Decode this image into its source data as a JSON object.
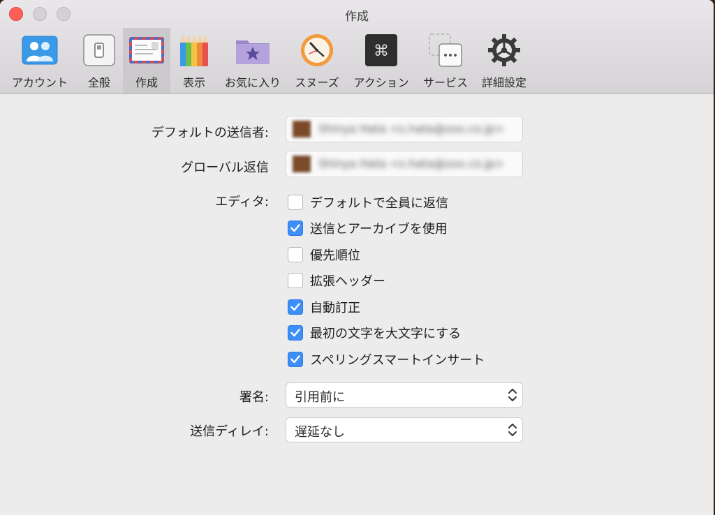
{
  "window": {
    "title": "作成"
  },
  "toolbar": {
    "items": [
      {
        "label": "アカウント",
        "icon": "accounts-icon"
      },
      {
        "label": "全般",
        "icon": "general-switch-icon"
      },
      {
        "label": "作成",
        "icon": "airmail-envelope-icon",
        "selected": true
      },
      {
        "label": "表示",
        "icon": "color-pencils-icon"
      },
      {
        "label": "お気に入り",
        "icon": "star-folder-icon"
      },
      {
        "label": "スヌーズ",
        "icon": "clock-icon"
      },
      {
        "label": "アクション",
        "icon": "command-key-icon"
      },
      {
        "label": "サービス",
        "icon": "services-dots-icon"
      },
      {
        "label": "詳細設定",
        "icon": "gear-icon"
      }
    ]
  },
  "compose": {
    "default_sender_label": "デフォルトの送信者:",
    "default_sender_value": "Shinya Hata <s.hata@xxx.co.jp>",
    "global_reply_label": "グローバル返信",
    "global_reply_value": "Shinya Hata <s.hata@xxx.co.jp>",
    "editor_label": "エディタ:",
    "options": [
      {
        "label": "デフォルトで全員に返信",
        "checked": false
      },
      {
        "label": "送信とアーカイブを使用",
        "checked": true
      },
      {
        "label": "優先順位",
        "checked": false
      },
      {
        "label": "拡張ヘッダー",
        "checked": false
      },
      {
        "label": "自動訂正",
        "checked": true
      },
      {
        "label": "最初の文字を大文字にする",
        "checked": true
      },
      {
        "label": "スペリングスマートインサート",
        "checked": true
      }
    ],
    "signature_label": "署名:",
    "signature_value": "引用前に",
    "send_delay_label": "送信ディレイ:",
    "send_delay_value": "遅延なし"
  },
  "colors": {
    "accent": "#3d8ef7",
    "close_button": "#ff5f57",
    "selected_tab": "#cbc9cb"
  }
}
